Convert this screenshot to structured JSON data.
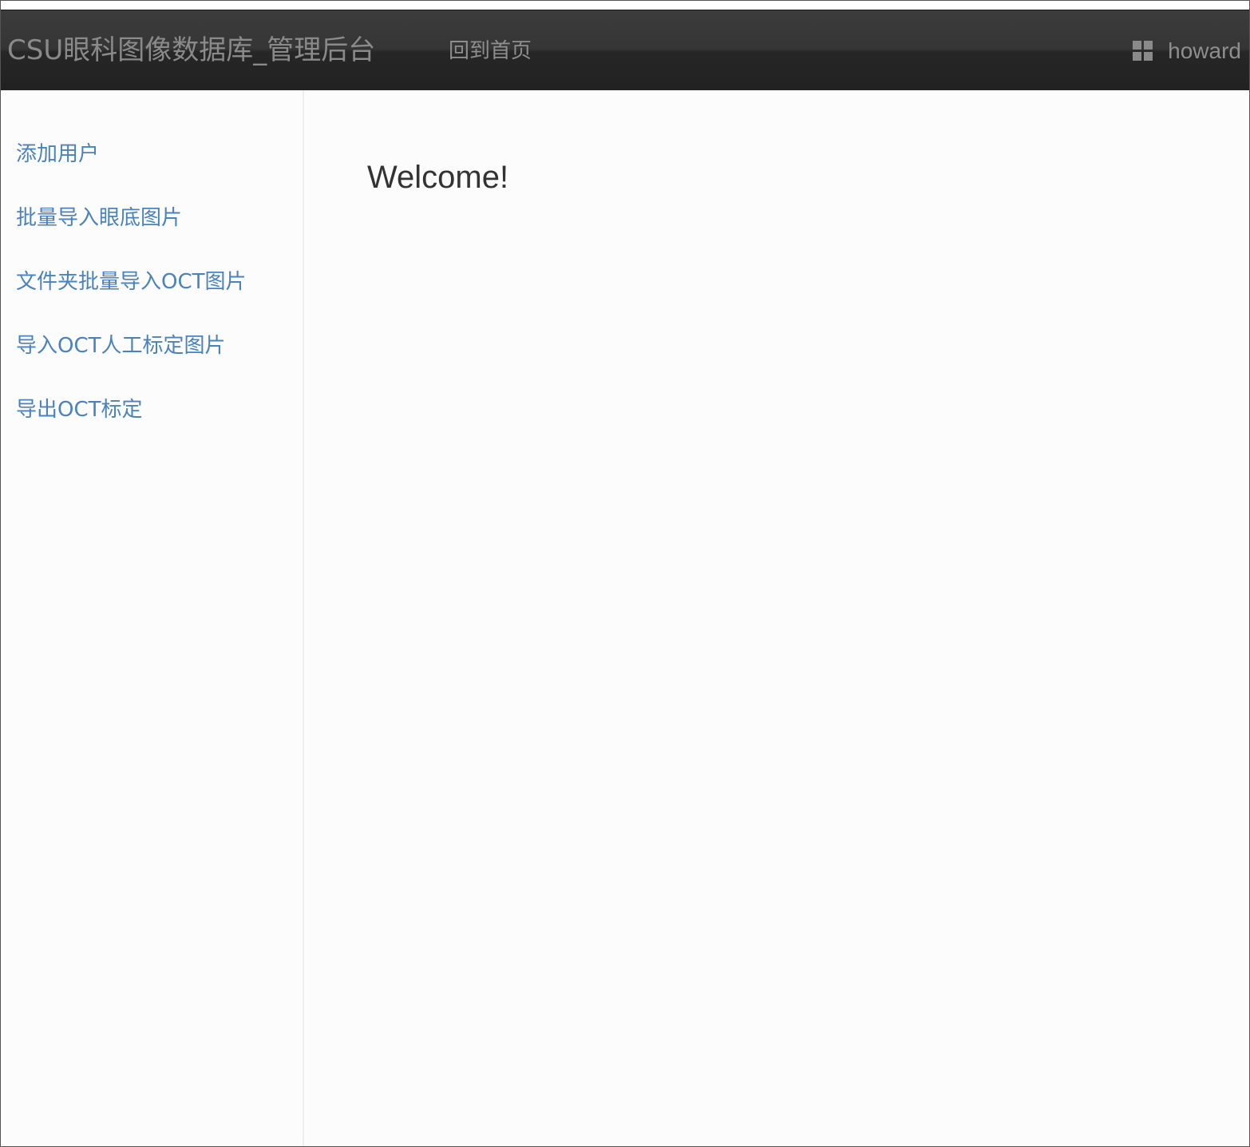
{
  "navbar": {
    "brand": "CSU眼科图像数据库_管理后台",
    "home_link": "回到首页",
    "user": {
      "icon": "grid-icon",
      "name": "howard"
    }
  },
  "sidebar": {
    "items": [
      {
        "label": "添加用户"
      },
      {
        "label": "批量导入眼底图片"
      },
      {
        "label": "文件夹批量导入OCT图片"
      },
      {
        "label": "导入OCT人工标定图片"
      },
      {
        "label": "导出OCT标定"
      }
    ]
  },
  "main": {
    "heading": "Welcome!"
  },
  "colors": {
    "navbar_bg": "#2a2a2a",
    "nav_text": "#8e8e8e",
    "link": "#4a82bb",
    "heading": "#333333",
    "page_bg": "#fcfcfc"
  }
}
